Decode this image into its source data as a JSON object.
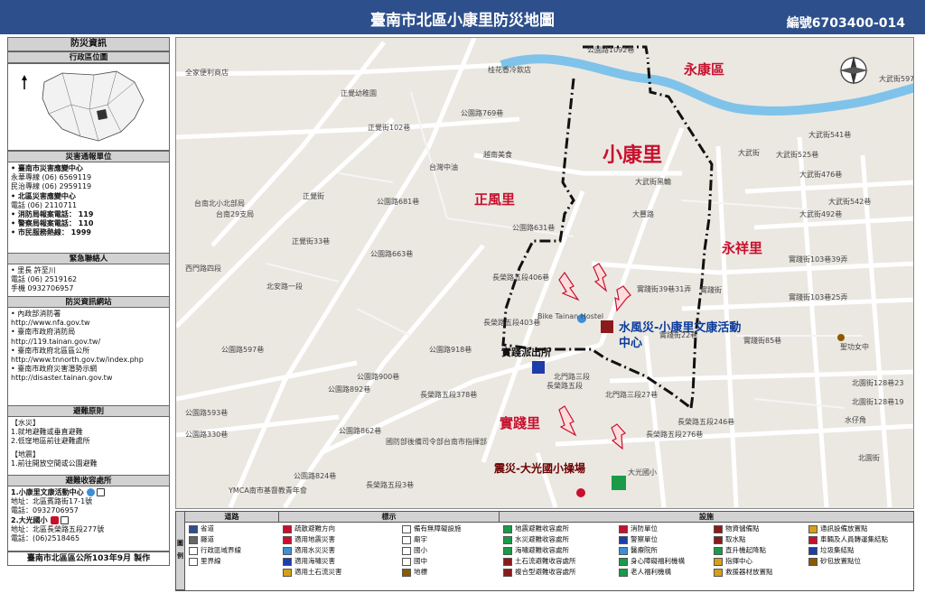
{
  "header": {
    "title": "臺南市北區小康里防災地圖",
    "map_no": "編號6703400-014"
  },
  "side": {
    "s1": "防災資訊",
    "s2": "行政區位圖",
    "s3": "災害通報單位",
    "report": [
      "• 臺南市災害應變中心",
      "永華專線 (06) 6569119",
      "民治專線 (06) 2959119",
      "• 北區災害應變中心",
      "電話 (06) 2110711",
      "• 消防局報案電話： 119",
      "• 警察局報案電話： 110",
      "• 市民服務熱線： 1999"
    ],
    "s4": "緊急聯絡人",
    "contact": [
      "• 里長 許至川",
      "電話 (06) 2519162",
      "手機 0932706957"
    ],
    "s5": "防災資訊網站",
    "web": [
      "• 內政部消防署",
      "http://www.nfa.gov.tw",
      "• 臺南市政府消防局",
      "http://119.tainan.gov.tw/",
      "• 臺南市政府北區區公所",
      "http://www.tnnorth.gov.tw/index.php",
      "• 臺南市政府災害潛勢示網",
      "http://disaster.tainan.gov.tw"
    ],
    "s6": "避難原則",
    "principle": [
      "【水災】",
      "1.就地避難或垂直避難",
      "2.低窪地區前往避難處所",
      "",
      "【地震】",
      "1.前往開放空間或公園避難"
    ],
    "s7": "避難收容處所",
    "shelter": [
      "1.小康里文康活動中心",
      "地址：北區賓路街17-1號",
      "電話：0932706957",
      "2.大光國小",
      "地址：北區長榮路五段277號",
      "電話：(06)2518465"
    ],
    "footer": "臺南市北區區公所103年9月  製作"
  },
  "map": {
    "regions": [
      "小康里",
      "正風里",
      "永康區",
      "永祥里",
      "實踐里"
    ],
    "facilities": [
      "水風災-小康里文康活動中心",
      "實踐派出所",
      "震災-大光國小操場"
    ],
    "streets": [
      "公園路1092巷",
      "桂花香冷飲店",
      "全家便利商店",
      "正覺幼稚園",
      "公園路769巷",
      "正覺街102巷",
      "台灣中油",
      "越南美食",
      "台南北小北部局",
      "台南29支局",
      "正覺街",
      "大武街黑輪",
      "大武街",
      "公園路681巷",
      "公園路631巷",
      "正覺街33巷",
      "公園路663巷",
      "西門路四段",
      "北安路一段",
      "公園路918巷",
      "公園路597巷",
      "公園路900巷",
      "公園路892巷",
      "公園路593巷",
      "公園路330巷",
      "長榮路五段",
      "實踐街39巷31弄",
      "實踐街103巷39弄",
      "實踐街103巷25弄",
      "實踐街",
      "北門路三段27巷",
      "實踐街85巷",
      "Bike Tainan Hostel",
      "國防部後備司令部台南市指揮部",
      "YMCA南市基督教青年會",
      "北園街128巷23",
      "北園街128巷19",
      "大光國小",
      "聖功女中",
      "水仔角",
      "北園街",
      "大武街476巷",
      "大武街492巷",
      "大武街542巷",
      "大武街525巷",
      "大武街541巷",
      "大武街597巷",
      "長榮路五段406巷",
      "長榮路五段403巷",
      "長榮路五段378巷",
      "實踐街22巷",
      "北門路三段",
      "長榮路五段246巷",
      "長榮路五段276巷",
      "公園路824巷",
      "公園路862巷",
      "大豐路",
      "長榮路五段3巷"
    ]
  },
  "legend": {
    "h_road": "道路",
    "h_mark": "標示",
    "h_fac": "設施",
    "side": "圖例",
    "road": [
      "省道",
      "縣道",
      "行政區域界線",
      "里界線"
    ],
    "mark": [
      "疏散避難方向",
      "適用地震災害",
      "適用水災災害",
      "適用海嘯災害",
      "適用土石流災害",
      "備有無障礙設施",
      "廟宇",
      "國小",
      "國中",
      "地標"
    ],
    "fac": [
      "地震避難收容處所",
      "水災避難收容處所",
      "海嘯避難收容處所",
      "土石流避難收容處所",
      "複合型避難收容處所",
      "消防單位",
      "警察單位",
      "醫療院所",
      "身心障礙福利機構",
      "老人福利機構",
      "物資儲備點",
      "取水點",
      "直升機起降點",
      "指揮中心",
      "救援器材放置點",
      "通訊設備放置點",
      "車輛及人員轉運集結點",
      "垃圾集結點",
      "砂包放置點位"
    ]
  },
  "colors": {
    "header": "#2d4f8c",
    "river": "#7fc3ea",
    "road": "#ffffff",
    "border": "#111111",
    "accent": "#c8102e",
    "blue": "#0b3b9c"
  }
}
